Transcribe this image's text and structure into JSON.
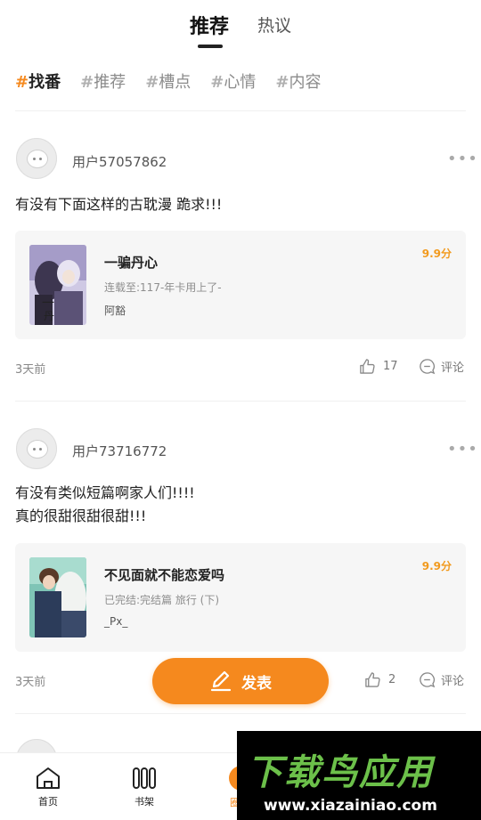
{
  "top_tabs": [
    {
      "label": "推荐"
    },
    {
      "label": "热议"
    }
  ],
  "tags": [
    {
      "hash": "#",
      "label": "找番"
    },
    {
      "hash": "#",
      "label": "推荐"
    },
    {
      "hash": "#",
      "label": "槽点"
    },
    {
      "hash": "#",
      "label": "心情"
    },
    {
      "hash": "#",
      "label": "内容"
    }
  ],
  "posts": [
    {
      "username": "用户57057862",
      "text_lines": [
        "有没有下面这样的古耽漫 跪求!!!"
      ],
      "card": {
        "title": "一骗丹心",
        "meta": "连载至:117-年卡用上了-",
        "author": "阿豁",
        "score": "9.9分",
        "cover_colors": [
          "#4a4566",
          "#c9c3df"
        ]
      },
      "time": "3天前",
      "likes": "17",
      "comment_label": "评论"
    },
    {
      "username": "用户73716772",
      "text_lines": [
        "有没有类似短篇啊家人们!!!!",
        "真的很甜很甜很甜!!!"
      ],
      "card": {
        "title": "不见面就不能恋爱吗",
        "meta": "已完结:完结篇 旅行 (下)",
        "author": "_Px_",
        "score": "9.9分",
        "cover_colors": [
          "#6bb8a8",
          "#2a3a52"
        ]
      },
      "time": "3天前",
      "likes": "2",
      "comment_label": "评论"
    }
  ],
  "fab": {
    "label": "发表",
    "icon": "pen-icon"
  },
  "bottom_nav": [
    {
      "label": "首页",
      "icon": "home-icon"
    },
    {
      "label": "书架",
      "icon": "bookshelf-icon"
    },
    {
      "label": "圈",
      "icon": "community-icon"
    }
  ],
  "watermark": {
    "logo": "下载鸟应用",
    "url": "www.xiazainiao.com"
  },
  "colors": {
    "accent": "#f5891e",
    "score": "#f29a1e"
  }
}
